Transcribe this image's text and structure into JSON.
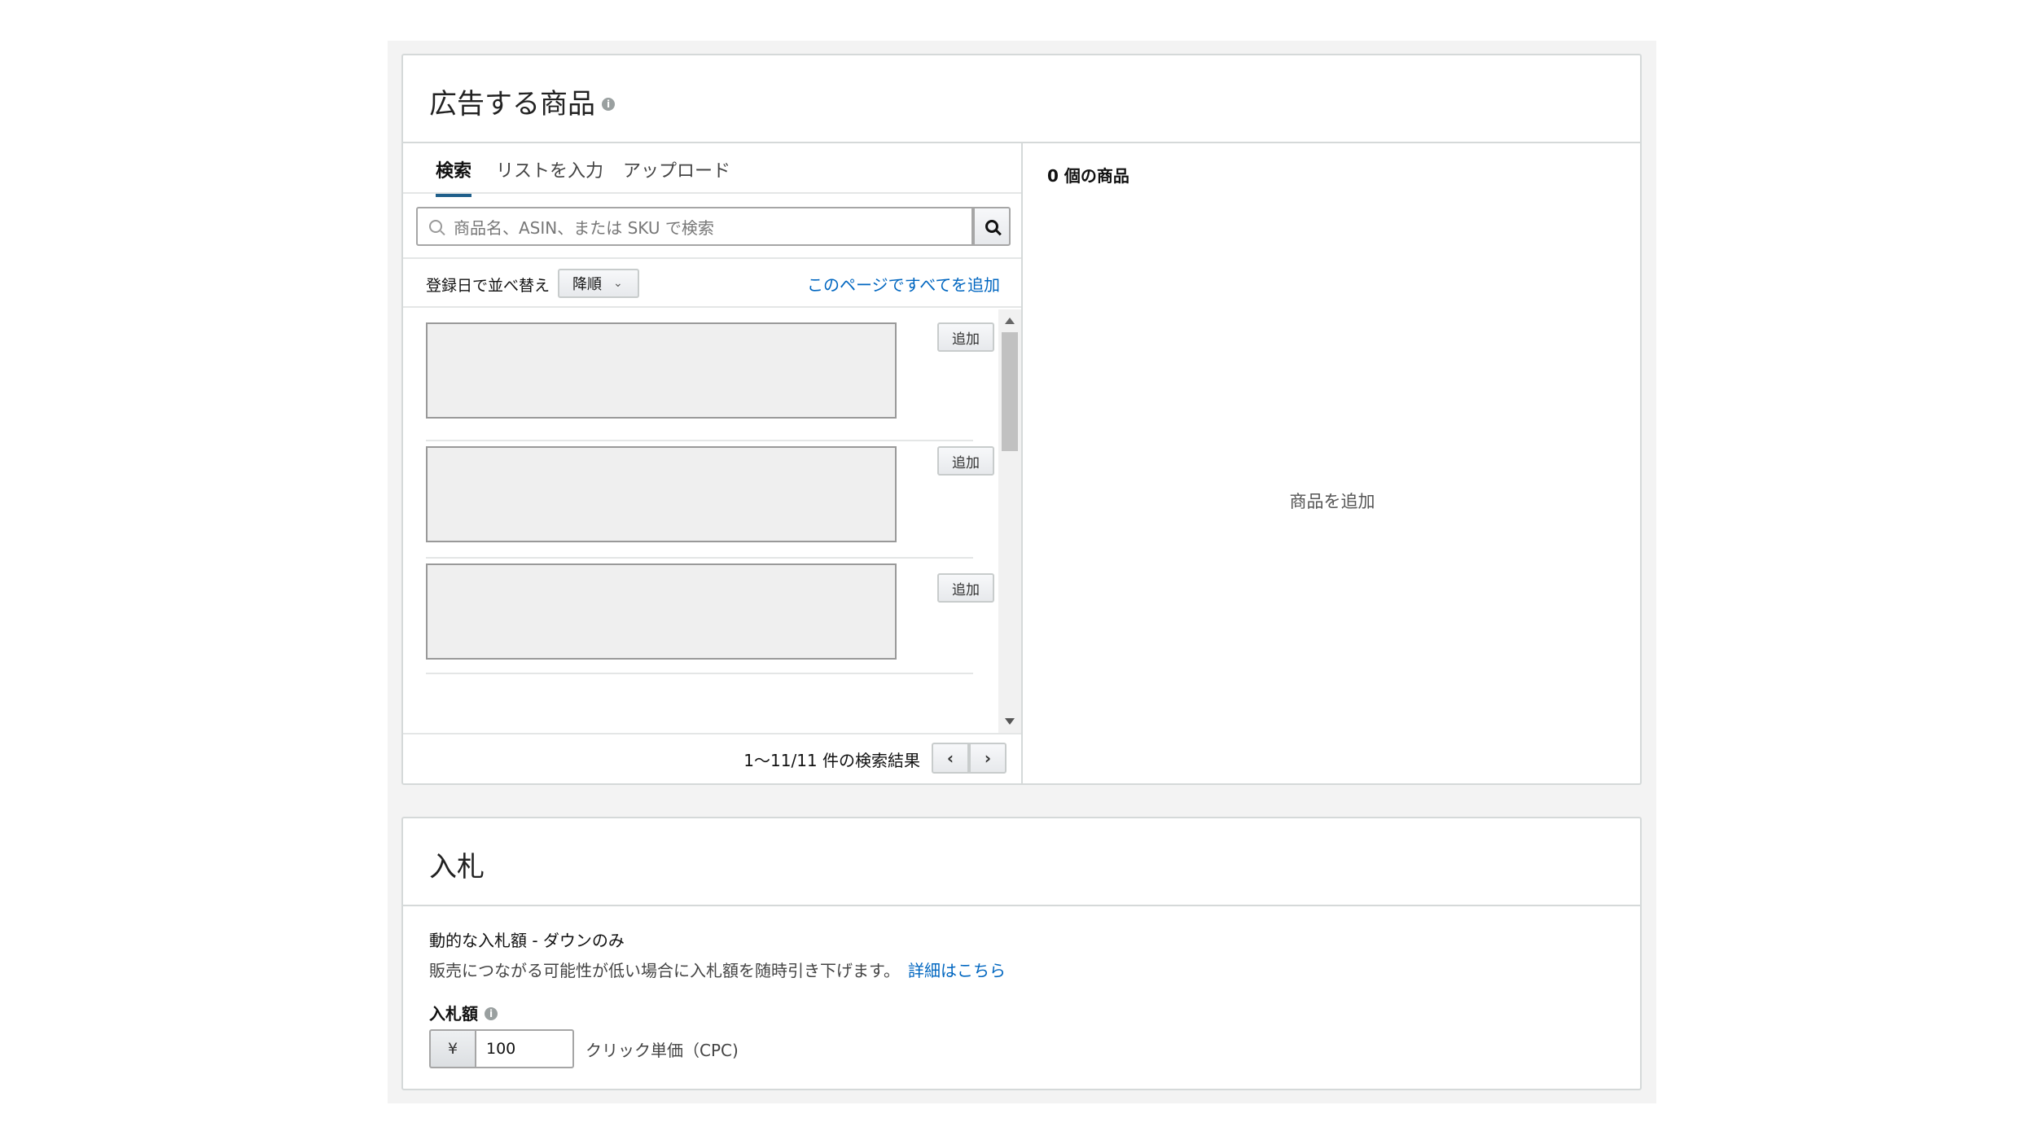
{
  "products": {
    "title": "広告する商品",
    "tabs": [
      "検索",
      "リストを入力",
      "アップロード"
    ],
    "search_placeholder": "商品名、ASIN、または SKU で検索",
    "sort_label": "登録日で並べ替え",
    "sort_value": "降順",
    "add_all": "このページですべてを追加",
    "add_label": "追加",
    "pager_text": "1～11/11 件の検索結果",
    "selected_count": "0 個の商品",
    "empty_message": "商品を追加"
  },
  "bid": {
    "title": "入札",
    "strategy": "動的な入札額 - ダウンのみ",
    "description": "販売につながる可能性が低い場合に入札額を随時引き下げます。",
    "learn_more": "詳細はこちら",
    "amount_label": "入札額",
    "currency": "¥",
    "amount": "100",
    "unit": "クリック単価（CPC)"
  }
}
